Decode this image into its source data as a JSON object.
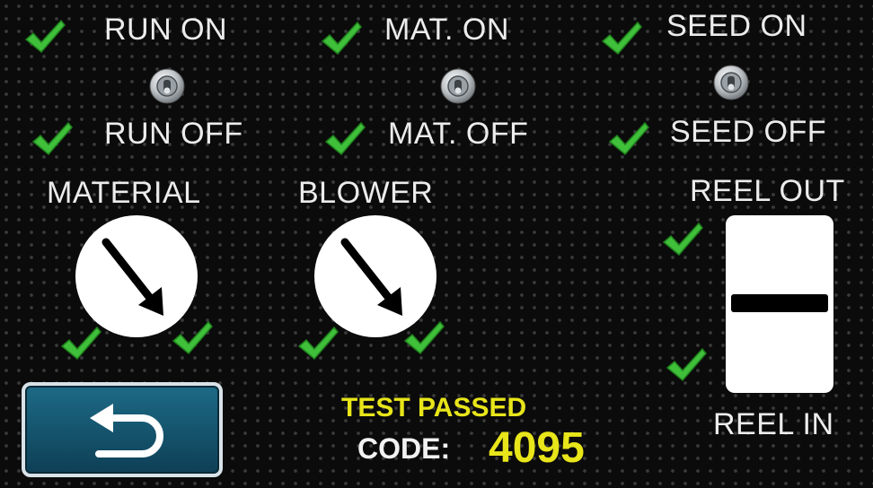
{
  "switches": [
    {
      "on_label": "RUN ON",
      "off_label": "RUN OFF"
    },
    {
      "on_label": "MAT. ON",
      "off_label": "MAT. OFF"
    },
    {
      "on_label": "SEED ON",
      "off_label": "SEED OFF"
    }
  ],
  "dials": {
    "material_label": "MATERIAL",
    "blower_label": "BLOWER"
  },
  "reel": {
    "out_label": "REEL OUT",
    "in_label": "REEL IN"
  },
  "status": {
    "result": "TEST PASSED",
    "code_label": "CODE:",
    "code_value": "4095"
  },
  "colors": {
    "check": "#3fbf3a",
    "status_yellow": "#e8e51a",
    "button_blue": "#1d6a86"
  },
  "icons": {
    "check": "check-icon",
    "toggle": "toggle-switch-icon",
    "back": "back-arrow-icon"
  }
}
